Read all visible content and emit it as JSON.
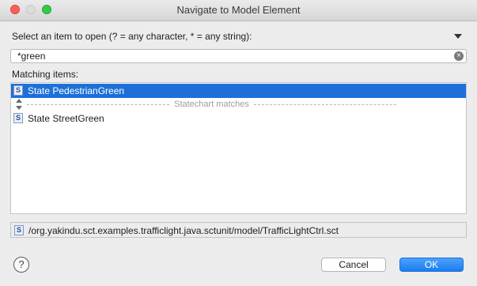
{
  "window": {
    "title": "Navigate to Model Element"
  },
  "prompt": "Select an item to open (? = any character, * = any string):",
  "search": {
    "value": "*green",
    "placeholder": ""
  },
  "matching_label": "Matching items:",
  "items": [
    {
      "icon": "S",
      "label": "State PedestrianGreen",
      "selected": true
    },
    {
      "icon": "S",
      "label": "State StreetGreen",
      "selected": false
    }
  ],
  "separator": "Statechart matches",
  "path": {
    "icon": "S",
    "text": "/org.yakindu.sct.examples.trafficlight.java.sctunit/model/TrafficLightCtrl.sct"
  },
  "buttons": {
    "help": "?",
    "cancel": "Cancel",
    "ok": "OK"
  },
  "colors": {
    "selection": "#1e70d8",
    "ok_button": "#1a7ef0"
  }
}
